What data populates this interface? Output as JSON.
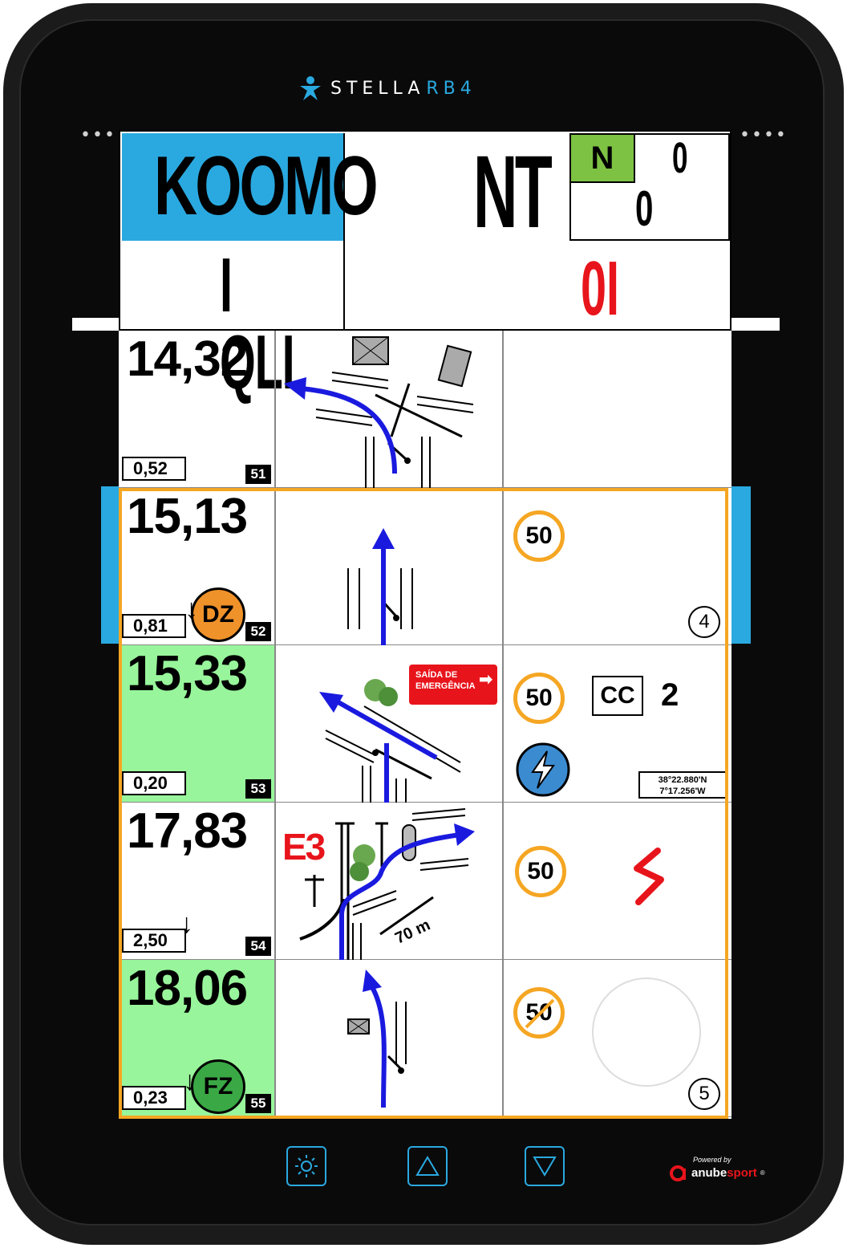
{
  "brand": {
    "name_a": "STELLA",
    "name_b": "RB4"
  },
  "bezel": {
    "dots_left": "••••",
    "dots_right": "••••"
  },
  "header": {
    "left_top": "KOOMO",
    "left_bottom": "I QLI",
    "center": "NT",
    "box_badge": "N",
    "box_top_value": "0",
    "box_bottom_value": "0",
    "red_value": "0I"
  },
  "rows": [
    {
      "distance": "14,32",
      "partial": "0,52",
      "number": "51"
    },
    {
      "distance": "15,13",
      "partial": "0,81",
      "number": "52",
      "zone": "DZ",
      "speed": "50",
      "circle_number": "4"
    },
    {
      "distance": "15,33",
      "partial": "0,20",
      "number": "53",
      "speed": "50",
      "cc_label": "CC",
      "cc_value": "2",
      "sign_line1": "SAÍDA DE",
      "sign_line2": "EMERGÊNCIA",
      "coord_lat": "38°22.880'N",
      "coord_lon": "7°17.256'W"
    },
    {
      "distance": "17,83",
      "partial": "2,50",
      "number": "54",
      "speed": "50",
      "waypoint": "E3",
      "tulip_distance": "70 m"
    },
    {
      "distance": "18,06",
      "partial": "0,23",
      "number": "55",
      "zone": "FZ",
      "speed": "50",
      "circle_number": "5"
    }
  ],
  "footer": {
    "powered_by": "Powered by",
    "company": "anubesport",
    "company_a": "anube",
    "company_b": "sport",
    "reg": "®"
  },
  "colors": {
    "accent_blue": "#2aa9e0",
    "frame_orange": "#f5a623",
    "green_cell": "#98f59b",
    "red": "#e8141b",
    "dz_orange": "#f0922a",
    "fz_green": "#3aa845"
  }
}
